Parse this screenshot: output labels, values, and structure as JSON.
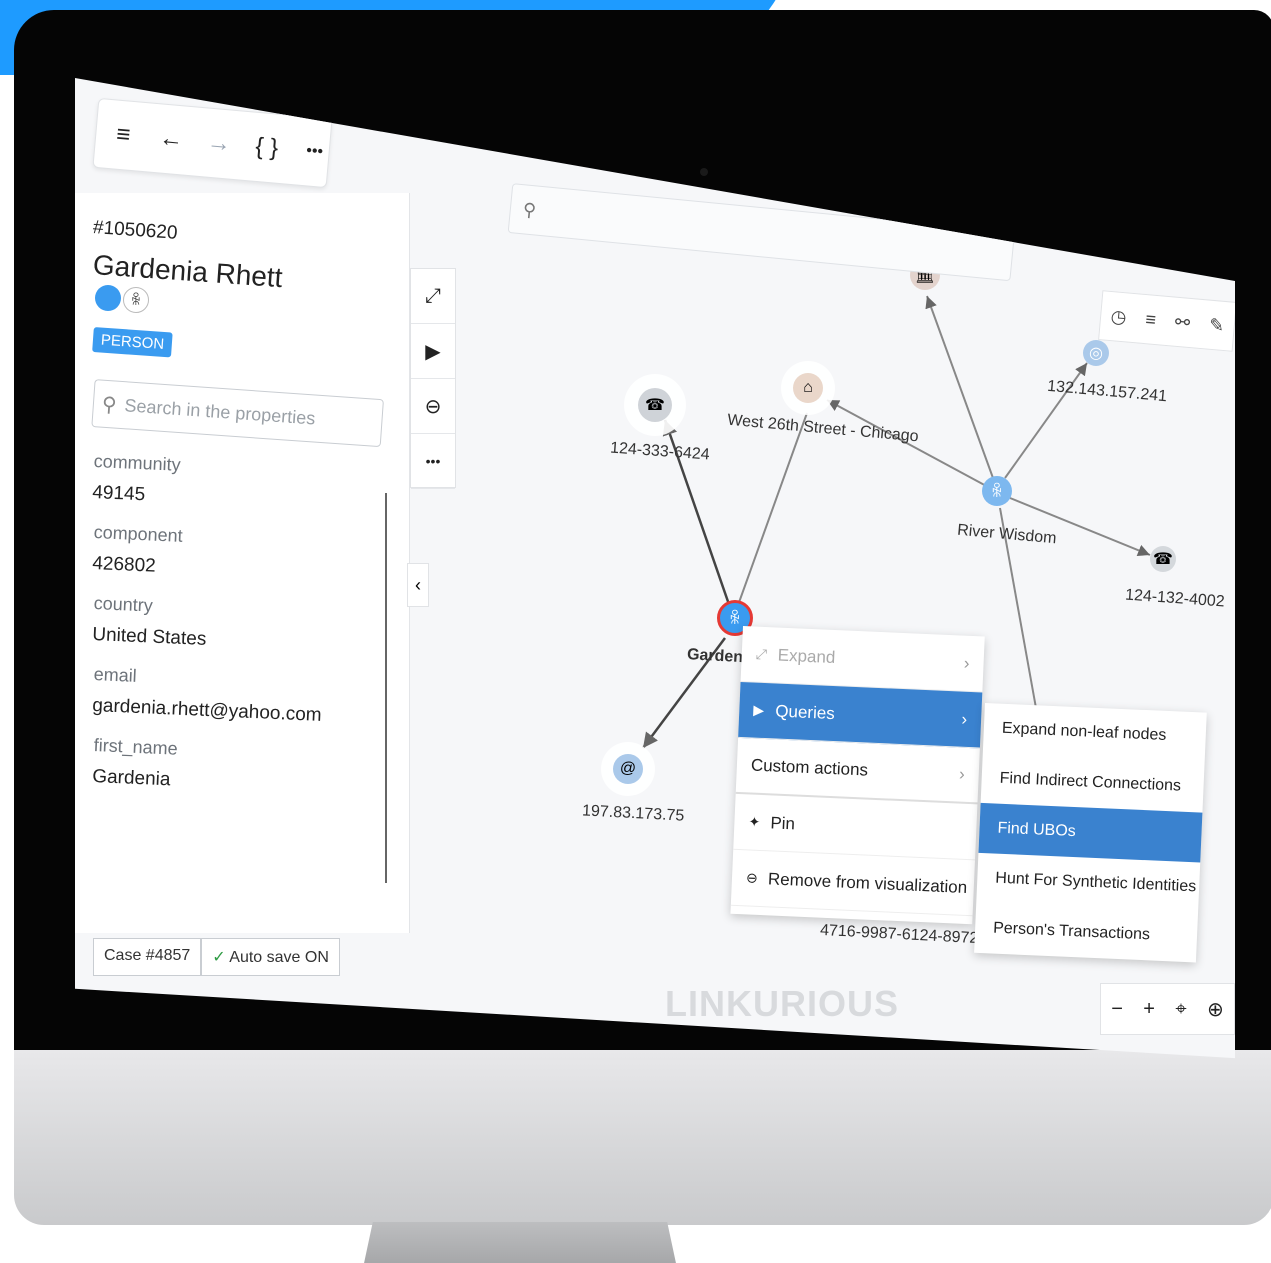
{
  "toolbar": {
    "menu": "≡",
    "back": "←",
    "forward": "→",
    "json": "{ }",
    "more": "•••"
  },
  "node": {
    "id": "#1050620",
    "name": "Gardenia Rhett",
    "category": "PERSON",
    "category_color": "#3a9bf0",
    "person_icon": "ꆜ"
  },
  "search": {
    "placeholder": "Search in the properties",
    "icon": "⚲"
  },
  "properties": [
    {
      "label": "community",
      "value": "49145"
    },
    {
      "label": "component",
      "value": "426802"
    },
    {
      "label": "country",
      "value": "United States"
    },
    {
      "label": "email",
      "value": "gardenia.rhett@yahoo.com"
    },
    {
      "label": "first_name",
      "value": "Gardenia"
    }
  ],
  "side_actions": {
    "expand": "⤢",
    "play": "▶",
    "remove": "⊖",
    "more": "•••",
    "collapse": "‹"
  },
  "status": {
    "case": "Case #4857",
    "autosave_icon": "✓",
    "autosave": "Auto save ON"
  },
  "canvas_search": {
    "icon": "⚲",
    "placeholder": ""
  },
  "graph_tools": {
    "clock": "◷",
    "filter": "≡",
    "layout": "⚯",
    "brush": "✎"
  },
  "graph": {
    "phone1": {
      "label": "124-333-6424",
      "icon": "☎"
    },
    "address": {
      "label": "West 26th Street - Chicago",
      "icon": "⌂"
    },
    "bank": {
      "icon": "🏛"
    },
    "ip1": {
      "label": "132.143.157.241",
      "icon": "◎"
    },
    "river": {
      "label": "River Wisdom",
      "icon": "ꆜ"
    },
    "phone2": {
      "label": "124-132-4002",
      "icon": "☎"
    },
    "gardenia": {
      "label": "Gardenia",
      "icon": "ꆜ"
    },
    "email": {
      "label": "197.83.173.75",
      "icon": "@"
    },
    "card": {
      "label": "4716-9987-6124-8972"
    }
  },
  "context_menu": {
    "expand": {
      "label": "Expand",
      "icon": "⤢"
    },
    "queries": {
      "label": "Queries",
      "icon": "▶"
    },
    "custom": {
      "label": "Custom actions"
    },
    "pin": {
      "label": "Pin",
      "icon": "✦"
    },
    "remove": {
      "label": "Remove from visualization",
      "icon": "⊖"
    },
    "arrow": "›"
  },
  "submenu": [
    "Expand non-leaf nodes",
    "Find Indirect Connections",
    "Find UBOs",
    "Hunt For Synthetic Identities",
    "Person's Transactions"
  ],
  "zoom": {
    "minus": "−",
    "plus": "+",
    "locate": "⌖",
    "globe": "⊕"
  },
  "watermark": "LINKURIOUS"
}
